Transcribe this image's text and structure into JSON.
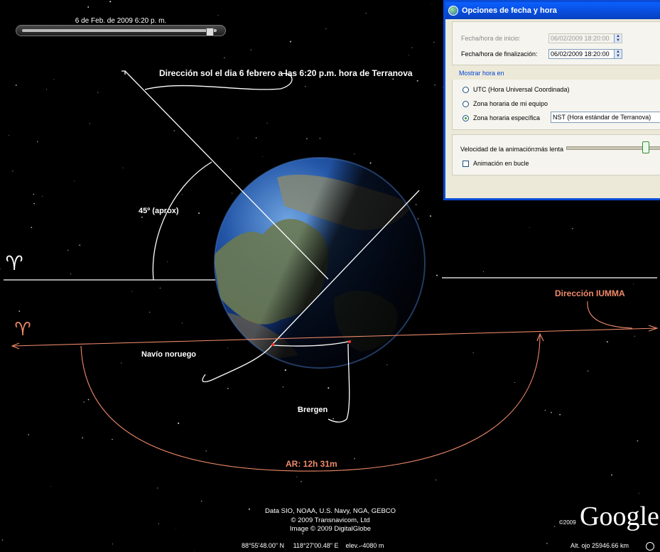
{
  "time_slider": {
    "date_label": "6 de Feb. de 2009   6:20 p. m.",
    "position": 0.97
  },
  "annotations": {
    "sun_direction": "Dirección sol el dia 6 febrero a las 6:20 p.m. hora de Terranova",
    "angle": "45º (aprox)",
    "iumma_direction": "Dirección IUMMA",
    "ship": "Navío noruego",
    "bergen": "Brergen",
    "right_ascension": "AR: 12h 31m",
    "aries_symbol_top": "♈",
    "aries_symbol_bottom": "♈"
  },
  "colors": {
    "annotation_white": "#ffffff",
    "annotation_orange": "#f08a6a",
    "dialog_title": "#0a5cf0"
  },
  "dialog": {
    "title": "Opciones de fecha y hora",
    "start_label": "Fecha/hora de inicio:",
    "start_value": "06/02/2009 18:20:00",
    "end_label": "Fecha/hora de finalización:",
    "end_value": "06/02/2009 18:20:00",
    "show_time_in": "Mostrar hora en",
    "radio_utc": "UTC (Hora Universal Coordinada)",
    "radio_local": "Zona horaria de mi equipo",
    "radio_specific": "Zona horaria específica",
    "timezone_value": "NST (Hora estándar de Terranova)",
    "speed_label": "Velocidad de la animación:",
    "speed_slow": "más lenta",
    "speed_level": 0.8,
    "loop_label": "Animación en bucle"
  },
  "credits": {
    "line1": "Data SIO, NOAA, U.S. Navy, NGA, GEBCO",
    "line2": "© 2009 Transnavicom, Ltd",
    "line3": "Image © 2009 DigitalGlobe"
  },
  "logo": {
    "year": "©2009",
    "name": "Google"
  },
  "status": {
    "lat": "88°55'48.00\" N",
    "lon": "118°27'00.48\" E",
    "elev": "elev.  -4080 m",
    "eye_alt": "Alt. ojo 25946.66 km"
  }
}
